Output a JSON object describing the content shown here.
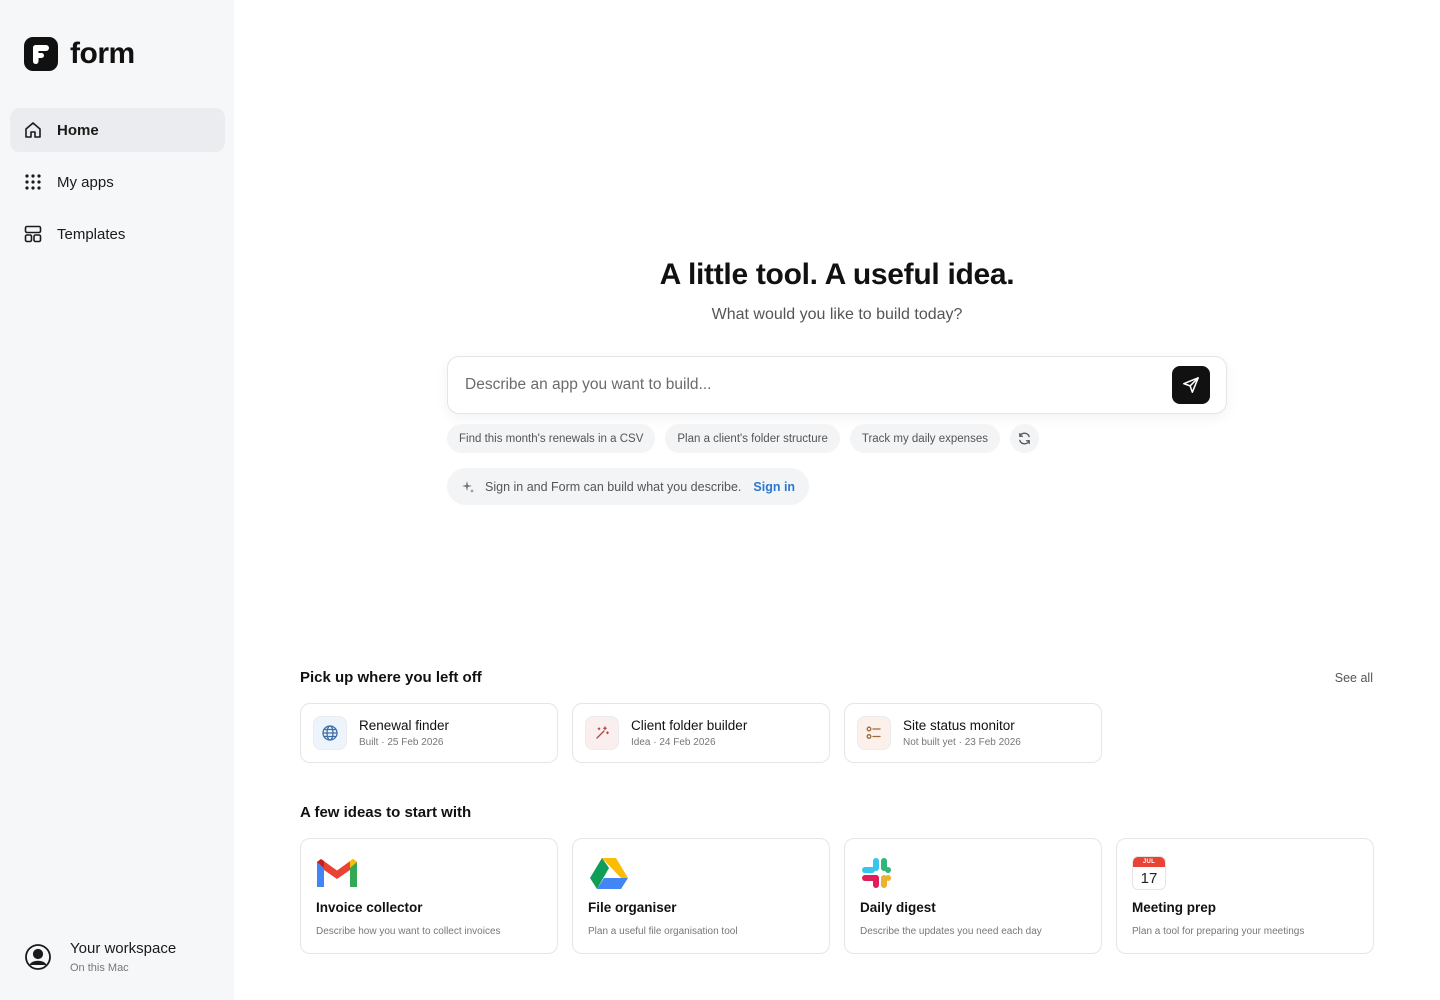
{
  "brand": {
    "name": "form"
  },
  "nav": {
    "items": [
      {
        "label": "Home",
        "icon": "home-icon",
        "active": true
      },
      {
        "label": "My apps",
        "icon": "grid-icon",
        "active": false
      },
      {
        "label": "Templates",
        "icon": "layout-icon",
        "active": false
      }
    ]
  },
  "workspace": {
    "title": "Your workspace",
    "subtitle": "On this Mac"
  },
  "hero": {
    "title": "A little tool. A useful idea.",
    "subtitle": "What would you like to build today?",
    "input_placeholder": "Describe an app you want to build..."
  },
  "suggestions": [
    "Find this month's renewals in a CSV",
    "Plan a client's folder structure",
    "Track my daily expenses"
  ],
  "signin": {
    "text": "Sign in and Form can build what you describe.",
    "link": "Sign in"
  },
  "recent": {
    "title": "Pick up where you left off",
    "see_all": "See all",
    "items": [
      {
        "name": "Renewal finder",
        "meta": "Built · 25 Feb 2026",
        "icon": "globe-icon"
      },
      {
        "name": "Client folder builder",
        "meta": "Idea · 24 Feb 2026",
        "icon": "magic-wand-icon"
      },
      {
        "name": "Site status monitor",
        "meta": "Not built yet · 23 Feb 2026",
        "icon": "checklist-icon"
      }
    ]
  },
  "ideas": {
    "title": "A few ideas to start with",
    "items": [
      {
        "name": "Invoice collector",
        "desc": "Describe how you want to collect invoices",
        "icon": "gmail-icon"
      },
      {
        "name": "File organiser",
        "desc": "Plan a useful file organisation tool",
        "icon": "google-drive-icon"
      },
      {
        "name": "Daily digest",
        "desc": "Describe the updates you need each day",
        "icon": "slack-icon"
      },
      {
        "name": "Meeting prep",
        "desc": "Plan a tool for preparing your meetings",
        "icon": "calendar-icon",
        "cal_month": "JUL",
        "cal_day": "17"
      }
    ]
  },
  "colors": {
    "accent_link": "#2b78d0",
    "sidebar_bg": "#f6f7f9",
    "send_button": "#111111"
  }
}
